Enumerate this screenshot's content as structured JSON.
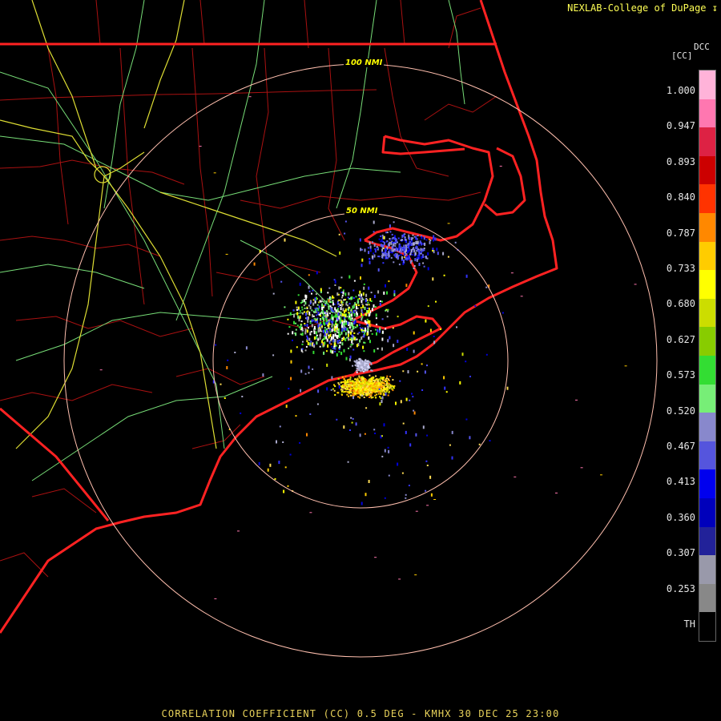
{
  "credit": "NEXLAB-College of DuPage",
  "logo_icon": "college-of-dupage-logo-icon",
  "scale": {
    "title_top": "DCC",
    "title_bottom": "[CC]",
    "labels": [
      "1.000",
      "0.947",
      "0.893",
      "0.840",
      "0.787",
      "0.733",
      "0.680",
      "0.627",
      "0.573",
      "0.520",
      "0.467",
      "0.413",
      "0.360",
      "0.307",
      "0.253",
      "TH"
    ],
    "colors": [
      "#ffb3d9",
      "#ff77b0",
      "#dd2244",
      "#cc0000",
      "#ff3300",
      "#ff8800",
      "#ffcc00",
      "#ffff00",
      "#ccdd00",
      "#88cc00",
      "#33dd33",
      "#77ee77",
      "#8888cc",
      "#5555dd",
      "#0000ee",
      "#0000bb",
      "#222299",
      "#9999aa",
      "#888888",
      "#000000"
    ]
  },
  "range_rings": {
    "inner_label": "50 NMI",
    "outer_label": "100 NMI"
  },
  "footer": "CORRELATION COEFFICIENT (CC) 0.5 DEG - KMHX 30 DEC 25 23:00"
}
